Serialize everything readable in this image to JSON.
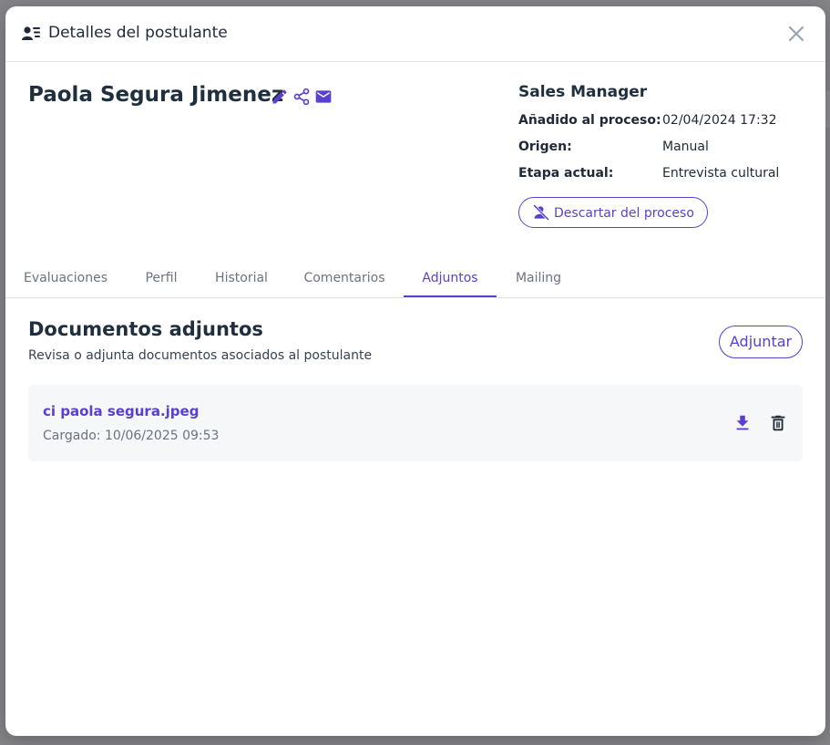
{
  "colors": {
    "accent": "#5b3fd0",
    "text_dark": "#1f2f3d",
    "muted": "#6b7280",
    "card_bg": "#f6f7f9"
  },
  "modal": {
    "title": "Detalles del postulante",
    "header_icon": "person-list-icon",
    "close_icon": "close-icon"
  },
  "candidate": {
    "name": "Paola Segura Jimenez",
    "actions": [
      "edit-icon",
      "share-icon",
      "email-icon"
    ]
  },
  "job": {
    "title": "Sales Manager",
    "added_label": "Añadido al proceso:",
    "added_value": "02/04/2024 17:32",
    "origin_label": "Origen:",
    "origin_value": "Manual",
    "stage_label": "Etapa actual:",
    "stage_value": "Entrevista cultural",
    "discard_label": "Descartar del proceso",
    "discard_icon": "person-off-icon"
  },
  "tabs": [
    {
      "label": "Evaluaciones",
      "active": false
    },
    {
      "label": "Perfil",
      "active": false
    },
    {
      "label": "Historial",
      "active": false
    },
    {
      "label": "Comentarios",
      "active": false
    },
    {
      "label": "Adjuntos",
      "active": true
    },
    {
      "label": "Mailing",
      "active": false
    }
  ],
  "attachments": {
    "title": "Documentos adjuntos",
    "subtitle": "Revisa o adjunta documentos asociados al postulante",
    "attach_label": "Adjuntar",
    "files": [
      {
        "name": "ci paola segura.jpeg",
        "uploaded": "Cargado: 10/06/2025 09:53",
        "download_icon": "download-icon",
        "delete_icon": "trash-icon"
      }
    ]
  }
}
